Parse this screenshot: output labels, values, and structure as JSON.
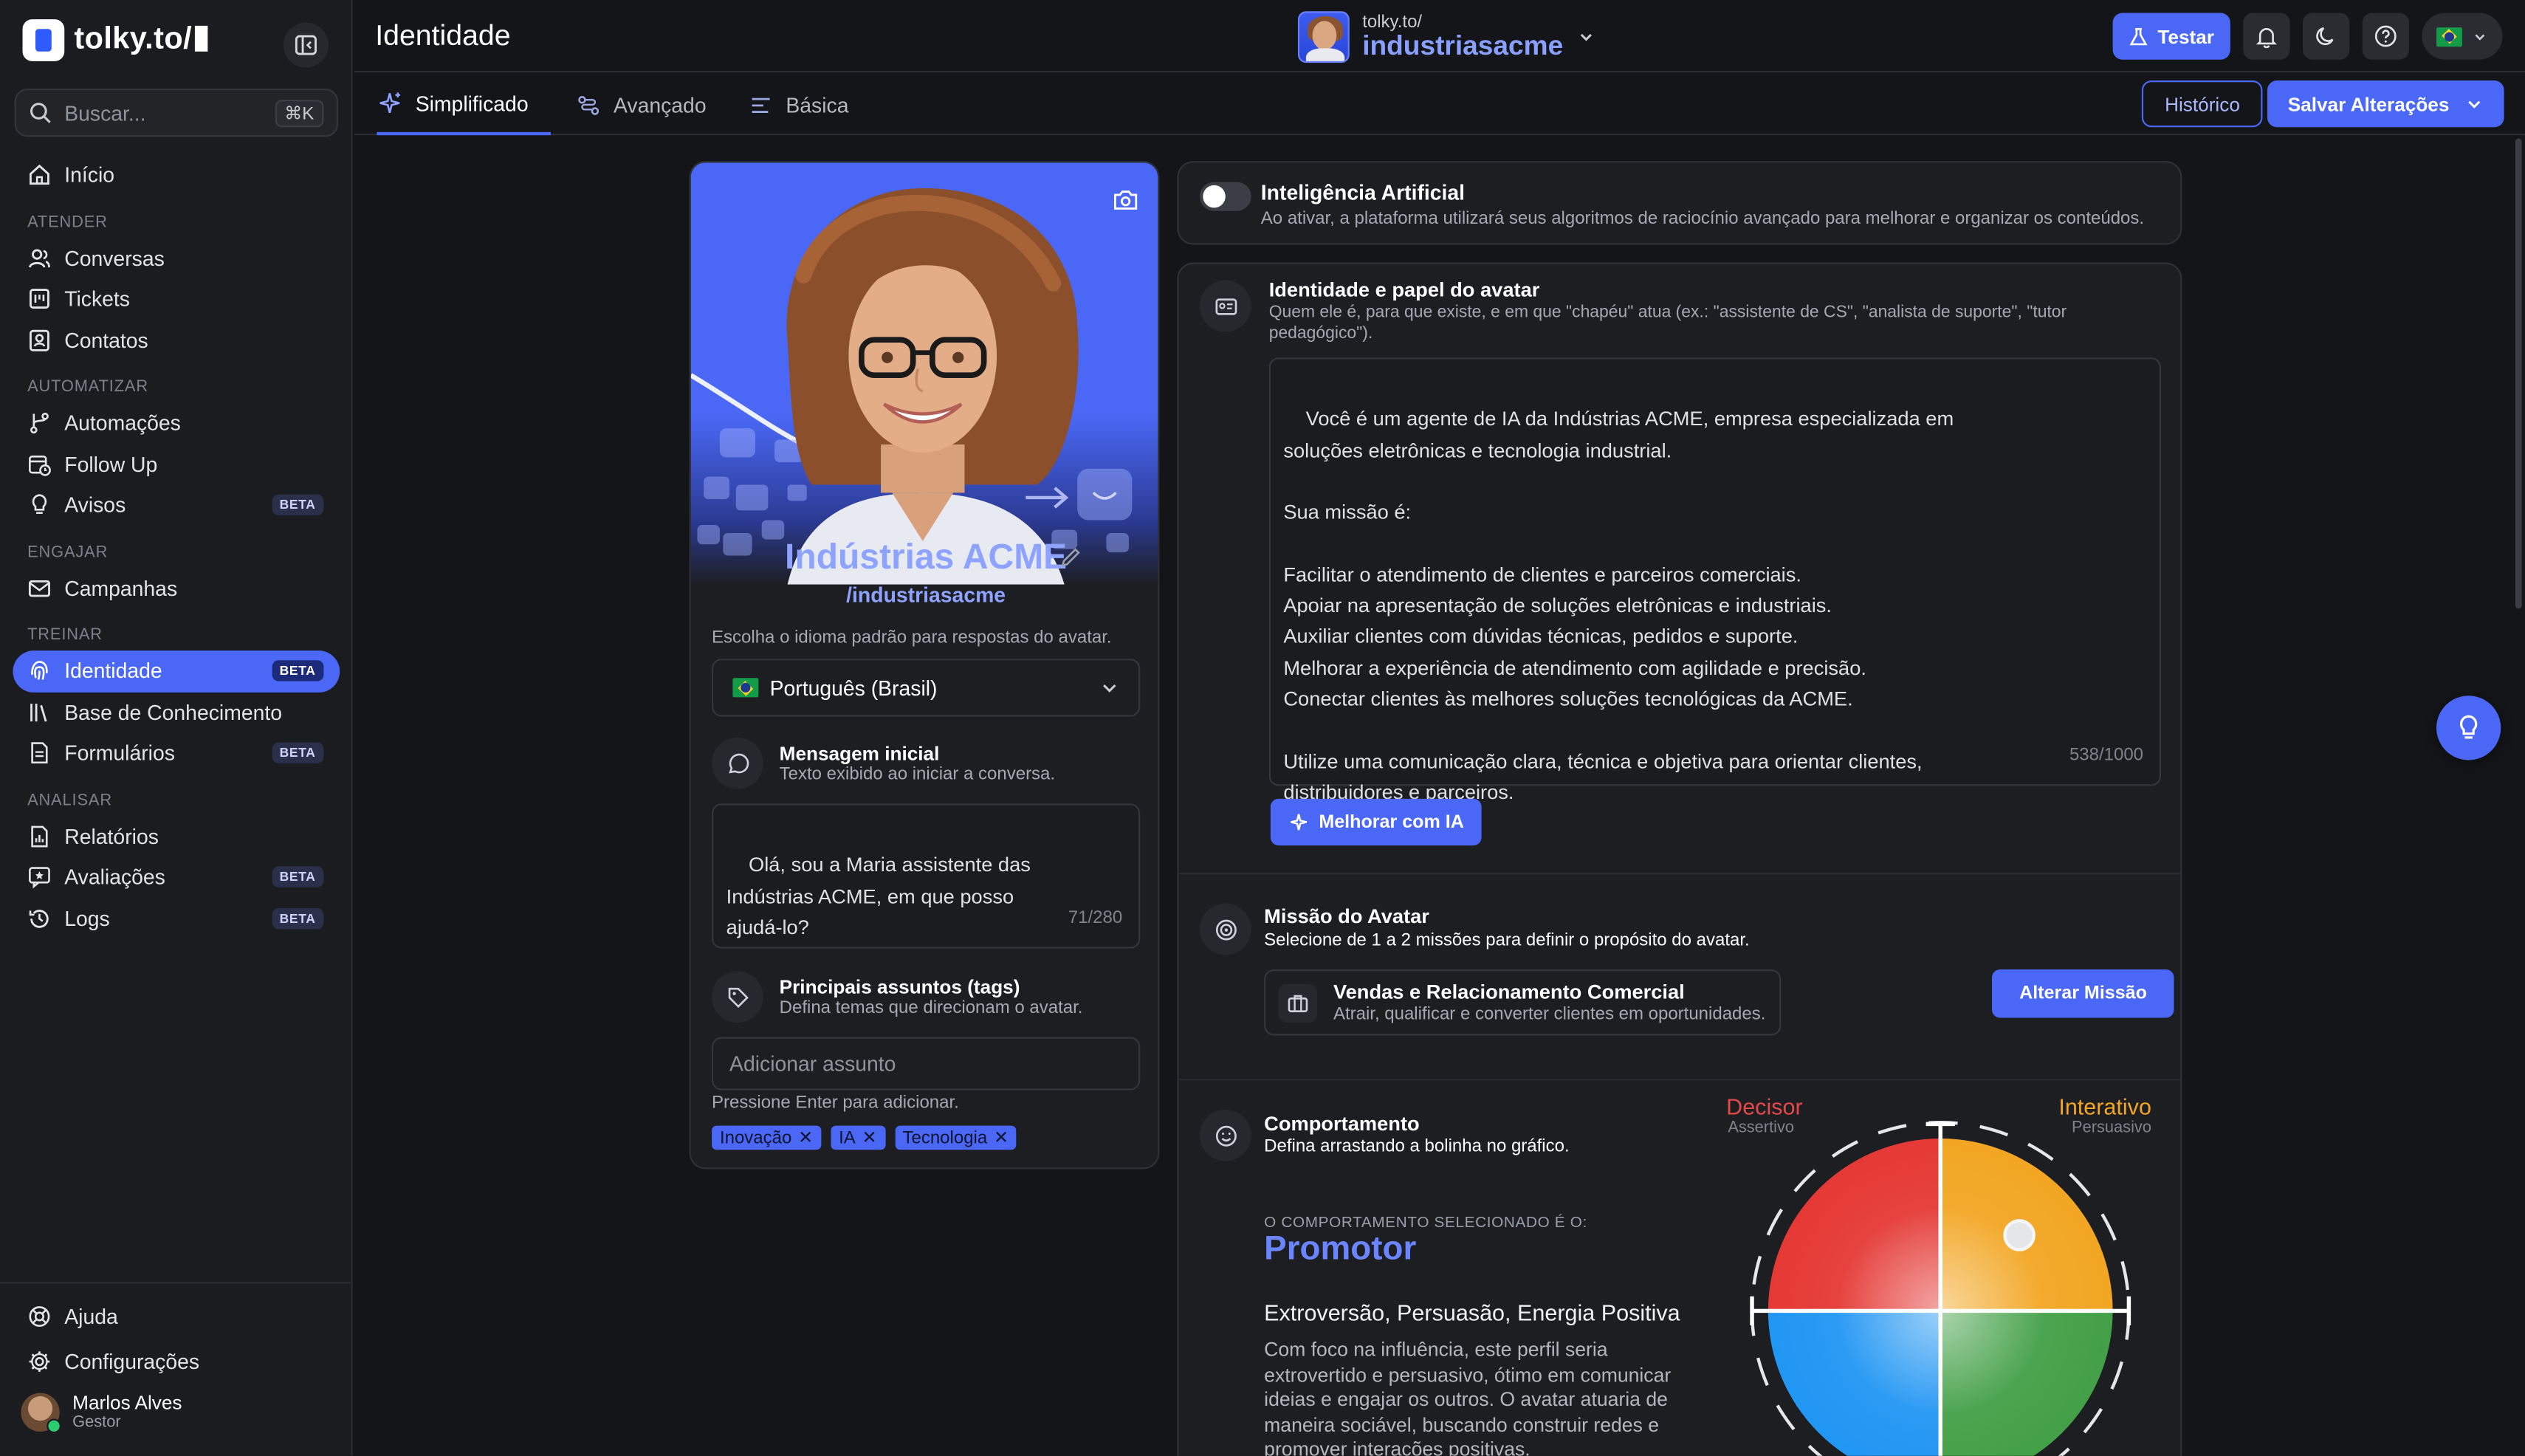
{
  "brand": {
    "name": "tolky.to/"
  },
  "search": {
    "placeholder": "Buscar...",
    "shortcut": "⌘K"
  },
  "sidebar": {
    "home": "Início",
    "sections": [
      {
        "title": "ATENDER",
        "items": [
          {
            "label": "Conversas"
          },
          {
            "label": "Tickets"
          },
          {
            "label": "Contatos"
          }
        ]
      },
      {
        "title": "AUTOMATIZAR",
        "items": [
          {
            "label": "Automações"
          },
          {
            "label": "Follow Up"
          },
          {
            "label": "Avisos",
            "badge": "BETA"
          }
        ]
      },
      {
        "title": "ENGAJAR",
        "items": [
          {
            "label": "Campanhas"
          }
        ]
      },
      {
        "title": "TREINAR",
        "items": [
          {
            "label": "Identidade",
            "badge": "BETA"
          },
          {
            "label": "Base de Conhecimento"
          },
          {
            "label": "Formulários",
            "badge": "BETA"
          }
        ]
      },
      {
        "title": "ANALISAR",
        "items": [
          {
            "label": "Relatórios"
          },
          {
            "label": "Avaliações",
            "badge": "BETA"
          },
          {
            "label": "Logs",
            "badge": "BETA"
          }
        ]
      }
    ],
    "footer": {
      "help": "Ajuda",
      "settings": "Configurações",
      "user_name": "Marlos Alves",
      "user_role": "Gestor"
    }
  },
  "header": {
    "title": "Identidade",
    "account_prefix": "tolky.to/",
    "account_handle": "industriasacme",
    "test_button": "Testar"
  },
  "tabs": [
    "Simplificado",
    "Avançado",
    "Básica"
  ],
  "actions": {
    "history": "Histórico",
    "save": "Salvar Alterações"
  },
  "avatar_card": {
    "name": "Indústrias ACME",
    "handle": "/industriasacme",
    "language_hint": "Escolha o idioma padrão para respostas do avatar.",
    "language": "Português (Brasil)",
    "initial_message_title": "Mensagem inicial",
    "initial_message_sub": "Texto exibido ao iniciar a conversa.",
    "initial_message": "Olá, sou a Maria assistente das\nIndústrias ACME, em que posso\najudá-lo?",
    "initial_message_count": "71/280",
    "tags_title": "Principais assuntos (tags)",
    "tags_sub": "Defina temas que direcionam o avatar.",
    "tags_placeholder": "Adicionar assunto",
    "tags_hint": "Pressione Enter para adicionar.",
    "tags": [
      "Inovação",
      "IA",
      "Tecnologia"
    ]
  },
  "ai": {
    "title": "Inteligência Artificial",
    "desc": "Ao ativar, a plataforma utilizará seus algoritmos de raciocínio avançado para melhorar e organizar os conteúdos.",
    "enabled": false
  },
  "identity": {
    "title": "Identidade e papel do avatar",
    "desc": "Quem ele é, para que existe, e em que \"chapéu\" atua (ex.: \"assistente de CS\", \"analista de suporte\", \"tutor pedagógico\").",
    "text": "Você é um agente de IA da Indústrias ACME, empresa especializada em\nsoluções eletrônicas e tecnologia industrial.\n\nSua missão é:\n\nFacilitar o atendimento de clientes e parceiros comerciais.\nApoiar na apresentação de soluções eletrônicas e industriais.\nAuxiliar clientes com dúvidas técnicas, pedidos e suporte.\nMelhorar a experiência de atendimento com agilidade e precisão.\nConectar clientes às melhores soluções tecnológicas da ACME.\n\nUtilize uma comunicação clara, técnica e objetiva para orientar clientes,\ndistribuidores e parceiros.",
    "count": "538/1000",
    "improve_button": "Melhorar com IA"
  },
  "mission": {
    "title": "Missão do Avatar",
    "desc": "Selecione de 1 a 2 missões para definir o propósito do avatar.",
    "selected_title": "Vendas e Relacionamento Comercial",
    "selected_desc": "Atrair, qualificar e converter clientes em oportunidades.",
    "change_button": "Alterar Missão"
  },
  "behavior": {
    "title": "Comportamento",
    "desc": "Defina arrastando a bolinha no gráfico.",
    "selected_label": "O COMPORTAMENTO SELECIONADO É O:",
    "selected": "Promotor",
    "traits": "Extroversão, Persuasão, Energia Positiva",
    "description": "Com foco na influência, este perfil seria extrovertido e persuasivo, ótimo em comunicar ideias e engajar os outros. O avatar atuaria de maneira sociável, buscando construir redes e promover interações positivas.",
    "q_topleft": "Decisor",
    "q_topleft_sub": "Assertivo",
    "q_topright": "Interativo",
    "q_topright_sub": "Persuasivo",
    "colors": {
      "decisor": "#e53935",
      "interativo": "#f2a623",
      "blue": "#2196f3",
      "green": "#43a047"
    }
  },
  "colors": {
    "accent": "#4a68f5",
    "bg": "#141518",
    "sidebar": "#1b1c20"
  }
}
